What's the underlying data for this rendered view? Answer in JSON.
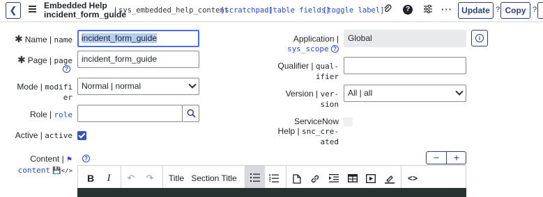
{
  "header": {
    "title_line1": "Embedded Help",
    "title_line2": "incident_form_guide",
    "separator": "|",
    "table": "sys_embedded_help_content",
    "links": [
      "[scratchpad]",
      "[table fields]",
      "[toggle label]"
    ],
    "update_label": "Update",
    "copy_label": "Copy",
    "help_mark": "?"
  },
  "form": {
    "name": {
      "label": "Name",
      "field": "name",
      "value": "incident_form_guide"
    },
    "page": {
      "label": "Page",
      "field": "page",
      "value": "incident_form_guide"
    },
    "mode": {
      "label": "Mode",
      "field_a": "modifi",
      "field_b": "er",
      "value": "Normal | normal"
    },
    "role": {
      "label": "Role",
      "field": "role",
      "value": ""
    },
    "active": {
      "label": "Active",
      "field": "active",
      "checked": true
    },
    "application": {
      "label": "Application",
      "field": "sys_scope",
      "value": "Global"
    },
    "qualifier": {
      "label": "Qualifier",
      "field_a": "qual-",
      "field_b": "ifier",
      "value": ""
    },
    "version": {
      "label": "Version",
      "field_a": "ver-",
      "field_b": "sion",
      "value": "All | all"
    },
    "servicenow_help": {
      "label_a": "ServiceNow",
      "label_b": "Help",
      "field_a": "snc_cre-",
      "field_b": "ated",
      "checked": false
    },
    "content": {
      "label": "Content",
      "field": "content"
    }
  },
  "editor": {
    "bold": "B",
    "italic": "I",
    "title_label": "Title",
    "section_title_label": "Section Title",
    "code_label": "<>"
  }
}
